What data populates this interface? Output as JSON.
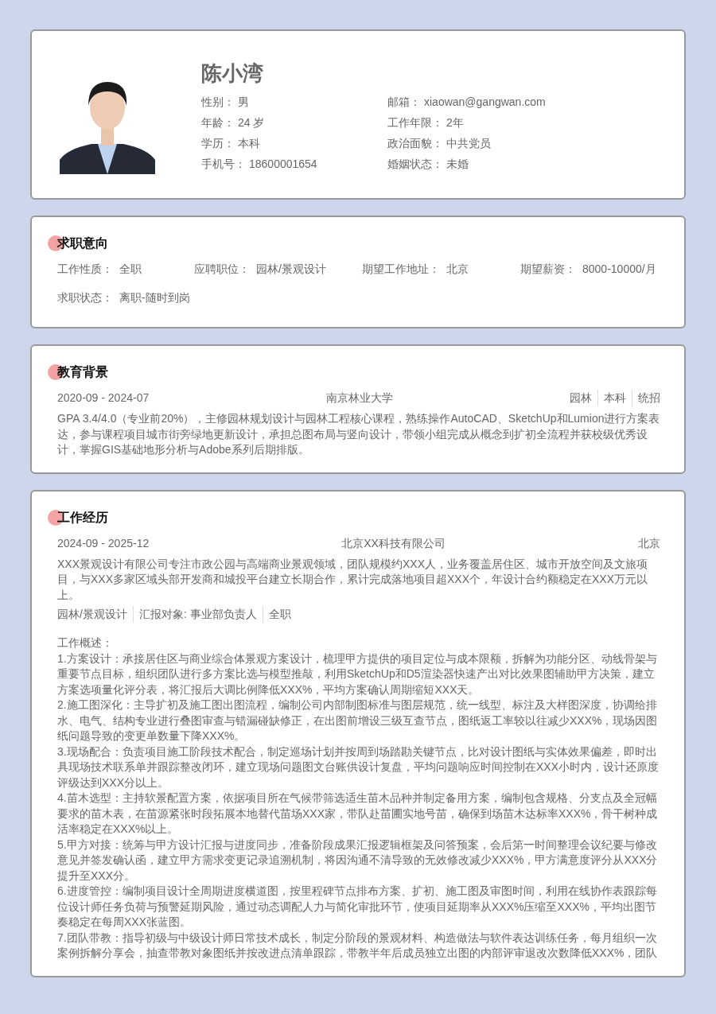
{
  "profile": {
    "name": "陈小湾",
    "left_fields": [
      {
        "label": "性别：",
        "value": "男"
      },
      {
        "label": "年龄：",
        "value": "24 岁"
      },
      {
        "label": "学历：",
        "value": "本科"
      },
      {
        "label": "手机号：",
        "value": "18600001654"
      }
    ],
    "right_fields": [
      {
        "label": "邮箱：",
        "value": "xiaowan@gangwan.com"
      },
      {
        "label": "工作年限：",
        "value": "2年"
      },
      {
        "label": "政治面貌：",
        "value": "中共党员"
      },
      {
        "label": "婚姻状态：",
        "value": "未婚"
      }
    ]
  },
  "job_intention": {
    "title": "求职意向",
    "fields": [
      {
        "label": "工作性质：",
        "value": "全职"
      },
      {
        "label": "应聘职位：",
        "value": "园林/景观设计"
      },
      {
        "label": "期望工作地址：",
        "value": "北京"
      },
      {
        "label": "期望薪资：",
        "value": "8000-10000/月"
      },
      {
        "label": "求职状态：",
        "value": "离职-随时到岗"
      }
    ]
  },
  "education": {
    "title": "教育背景",
    "entries": [
      {
        "period": "2020-09 - 2024-07",
        "school": "南京林业大学",
        "tags": [
          "园林",
          "本科",
          "统招"
        ],
        "description": "GPA 3.4/4.0（专业前20%），主修园林规划设计与园林工程核心课程，熟练操作AutoCAD、SketchUp和Lumion进行方案表达，参与课程项目城市街旁绿地更新设计，承担总图布局与竖向设计，带领小组完成从概念到扩初全流程并获校级优秀设计，掌握GIS基础地形分析与Adobe系列后期排版。"
      }
    ]
  },
  "work": {
    "title": "工作经历",
    "entries": [
      {
        "period": "2024-09 - 2025-12",
        "company": "北京XX科技有限公司",
        "location": "北京",
        "description": "XXX景观设计有限公司专注市政公园与高端商业景观领域，团队规模约XXX人，业务覆盖居住区、城市开放空间及文旅项目，与XXX多家区域头部开发商和城投平台建立长期合作，累计完成落地项目超XXX个，年设计合约额稳定在XXX万元以上。",
        "tags": [
          "园林/景观设计",
          "汇报对象: 事业部负责人",
          "全职"
        ],
        "overview_title": "工作概述：",
        "items": [
          "1.方案设计：承接居住区与商业综合体景观方案设计，梳理甲方提供的项目定位与成本限额，拆解为功能分区、动线骨架与重要节点目标，组织团队进行多方案比选与模型推敲，利用SketchUp和D5渲染器快速产出对比效果图辅助甲方决策，建立方案选项量化评分表，将汇报后大调比例降低XXX%，平均方案确认周期缩短XXX天。",
          "2.施工图深化：主导扩初及施工图出图流程，编制公司内部制图标准与图层规范，统一线型、标注及大样图深度，协调给排水、电气、结构专业进行叠图审查与错漏碰缺修正，在出图前增设三级互查节点，图纸返工率较以往减少XXX%，现场因图纸问题导致的变更单数量下降XXX%。",
          "3.现场配合：负责项目施工阶段技术配合，制定巡场计划并按周到场踏勘关键节点，比对设计图纸与实体效果偏差，即时出具现场技术联系单并跟踪整改闭环，建立现场问题图文台账供设计复盘，平均问题响应时间控制在XXX小时内，设计还原度评级达到XXX分以上。",
          "4.苗木选型：主持软景配置方案，依据项目所在气候带筛选适生苗木品种并制定备用方案，编制包含规格、分支点及全冠幅要求的苗木表，在苗源紧张时段拓展本地替代苗场XXX家，带队赴苗圃实地号苗，确保到场苗木达标率XXX%，骨干树种成活率稳定在XXX%以上。",
          "5.甲方对接：统筹与甲方设计汇报与进度同步，准备阶段成果汇报逻辑框架及问答预案，会后第一时间整理会议纪要与修改意见并签发确认函，建立甲方需求变更记录追溯机制，将因沟通不清导致的无效修改减少XXX%，甲方满意度评分从XXX分提升至XXX分。",
          "6.进度管控：编制项目设计全周期进度横道图，按里程碑节点排布方案、扩初、施工图及审图时间，利用在线协作表跟踪每位设计师任务负荷与预警延期风险，通过动态调配人力与简化审批环节，使项目延期率从XXX%压缩至XXX%，平均出图节奏稳定在每周XXX张蓝图。",
          "7.团队带教：指导初级与中级设计师日常技术成长，制定分阶段的景观材料、构造做法与软件表达训练任务，每月组织一次案例拆解分享会，抽查带教对象图纸并按改进点清单跟踪，带教半年后成员独立出图的内部评审退改次数降低XXX%，团队"
        ]
      }
    ]
  }
}
